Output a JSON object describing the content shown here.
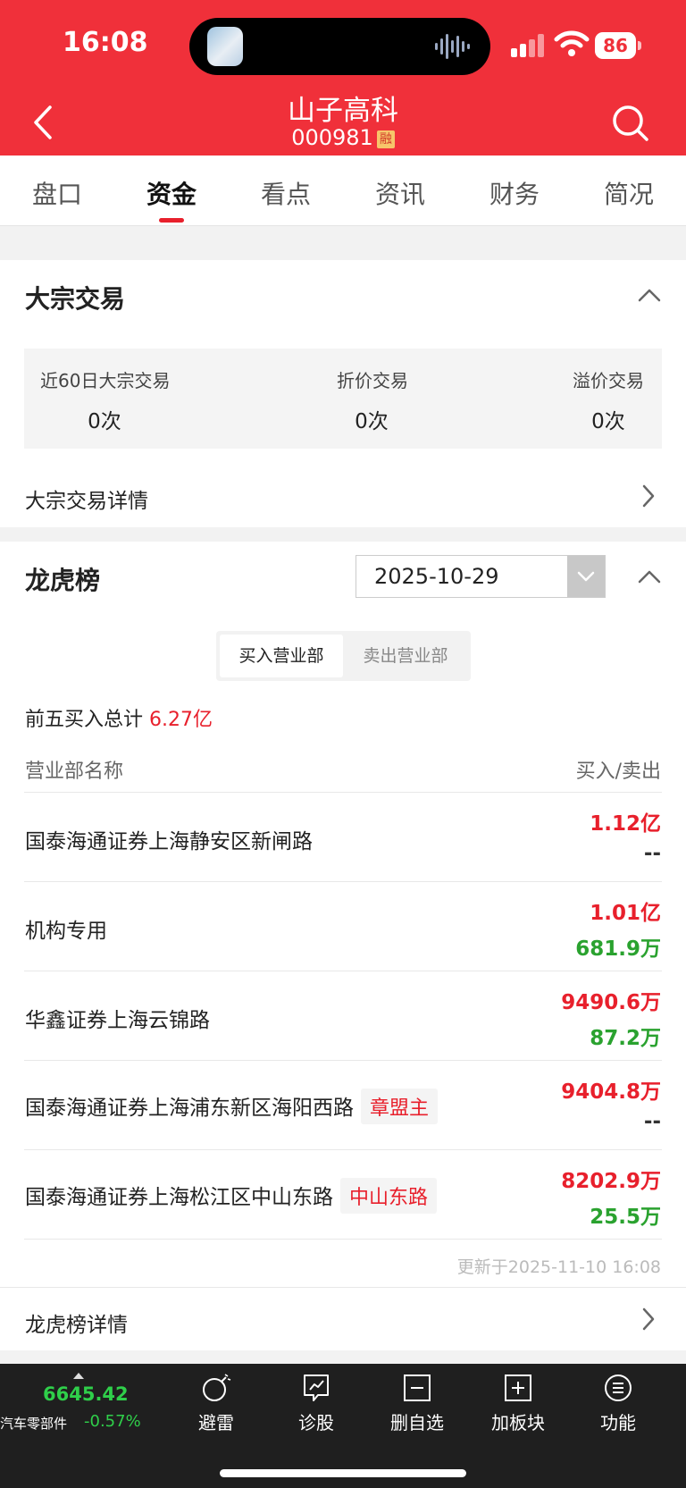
{
  "status_bar": {
    "time": "16:08",
    "battery": "86"
  },
  "header": {
    "title": "山子高科",
    "code": "000981",
    "badge": "融"
  },
  "tabs": [
    "盘口",
    "资金",
    "看点",
    "资讯",
    "财务",
    "简况"
  ],
  "active_tab": "资金",
  "block_trade": {
    "title": "大宗交易",
    "stats": [
      {
        "label": "近60日大宗交易",
        "value": "0次"
      },
      {
        "label": "折价交易",
        "value": "0次"
      },
      {
        "label": "溢价交易",
        "value": "0次"
      }
    ],
    "detail_link": "大宗交易详情"
  },
  "dragon_tiger": {
    "title": "龙虎榜",
    "date": "2025-10-29",
    "segment": {
      "buy": "买入营业部",
      "sell": "卖出营业部"
    },
    "total_label": "前五买入总计",
    "total_value": "6.27亿",
    "header_name": "营业部名称",
    "header_value": "买入/卖出",
    "rows": [
      {
        "name": "国泰海通证券上海静安区新闸路",
        "tag": "",
        "buy": "1.12亿",
        "sell": "--"
      },
      {
        "name": "机构专用",
        "tag": "",
        "buy": "1.01亿",
        "sell": "681.9万"
      },
      {
        "name": "华鑫证券上海云锦路",
        "tag": "",
        "buy": "9490.6万",
        "sell": "87.2万"
      },
      {
        "name": "国泰海通证券上海浦东新区海阳西路",
        "tag": "章盟主",
        "buy": "9404.8万",
        "sell": "--"
      },
      {
        "name": "国泰海通证券上海松江区中山东路",
        "tag": "中山东路",
        "buy": "8202.9万",
        "sell": "25.5万"
      }
    ],
    "updated": "更新于2025-11-10 16:08",
    "detail_link": "龙虎榜详情"
  },
  "bottom_bar": {
    "index_value": "6645.42",
    "index_name": "汽车零部件",
    "index_change": "-0.57%",
    "tools": [
      "避雷",
      "诊股",
      "删自选",
      "加板块",
      "功能"
    ]
  },
  "colors": {
    "brand_red": "#f0303a",
    "up_red": "#e8202c",
    "down_green": "#2aa22f"
  }
}
